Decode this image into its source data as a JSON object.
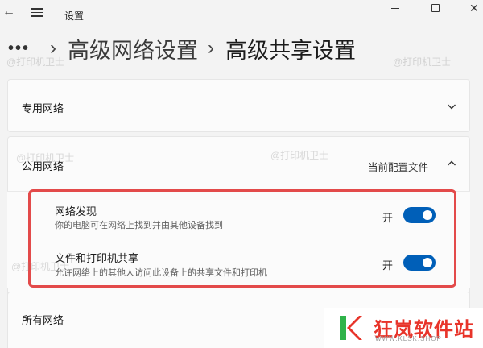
{
  "window": {
    "title": "设置",
    "back_glyph": "←",
    "close_glyph": "✕"
  },
  "breadcrumb": {
    "more": "•••",
    "separator": "›",
    "parent": "高级网络设置",
    "current": "高级共享设置"
  },
  "sections": {
    "private": {
      "title": "专用网络",
      "expanded": false
    },
    "public": {
      "title": "公用网络",
      "status": "当前配置文件",
      "expanded": true,
      "items": [
        {
          "title": "网络发现",
          "description": "你的电脑可在网络上找到并由其他设备找到",
          "toggle_label": "开",
          "on": true
        },
        {
          "title": "文件和打印机共享",
          "description": "允许网络上的其他人访问此设备上的共享文件和打印机",
          "toggle_label": "开",
          "on": true
        }
      ]
    },
    "all": {
      "title": "所有网络"
    }
  },
  "watermark": "@打印机卫士",
  "logo": {
    "name": "狂岚软件站",
    "url": "WWW.KLSK.SHOP"
  },
  "colors": {
    "accent": "#005fb8",
    "highlight": "#e34a4a",
    "logo_red": "#e8342a",
    "logo_green": "#2fb34a"
  }
}
